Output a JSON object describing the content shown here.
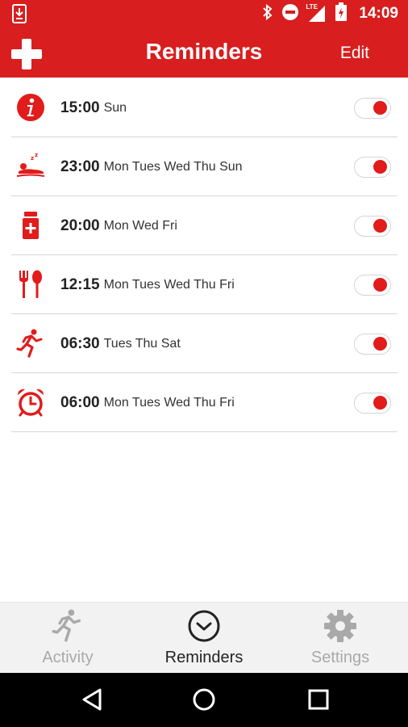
{
  "status_bar": {
    "time": "14:09",
    "network_label": "LTE",
    "icons": [
      "download-icon",
      "bluetooth-icon",
      "do-not-disturb-icon",
      "signal-icon",
      "battery-charging-icon"
    ]
  },
  "app_bar": {
    "title": "Reminders",
    "edit_label": "Edit",
    "add_icon": "plus-icon"
  },
  "colors": {
    "brand_red": "#d81e1e",
    "toggle_knob": "#e21b1b",
    "inactive_tab": "#a9a9a9",
    "active_tab": "#222222"
  },
  "reminders": [
    {
      "icon": "info-icon",
      "time": "15:00",
      "days": "Sun",
      "enabled": true
    },
    {
      "icon": "sleep-icon",
      "time": "23:00",
      "days": "Mon Tues Wed Thu Sun",
      "enabled": true
    },
    {
      "icon": "medicine-icon",
      "time": "20:00",
      "days": "Mon Wed Fri",
      "enabled": true
    },
    {
      "icon": "meal-icon",
      "time": "12:15",
      "days": "Mon Tues Wed Thu Fri",
      "enabled": true
    },
    {
      "icon": "running-icon",
      "time": "06:30",
      "days": "Tues Thu Sat",
      "enabled": true
    },
    {
      "icon": "alarm-clock-icon",
      "time": "06:00",
      "days": "Mon Tues Wed Thu Fri",
      "enabled": true
    }
  ],
  "bottom_nav": {
    "items": [
      {
        "label": "Activity",
        "icon": "running-icon",
        "active": false
      },
      {
        "label": "Reminders",
        "icon": "clock-icon",
        "active": true
      },
      {
        "label": "Settings",
        "icon": "gear-icon",
        "active": false
      }
    ]
  },
  "system_nav": {
    "icons": [
      "back-icon",
      "home-icon",
      "recents-icon"
    ]
  }
}
